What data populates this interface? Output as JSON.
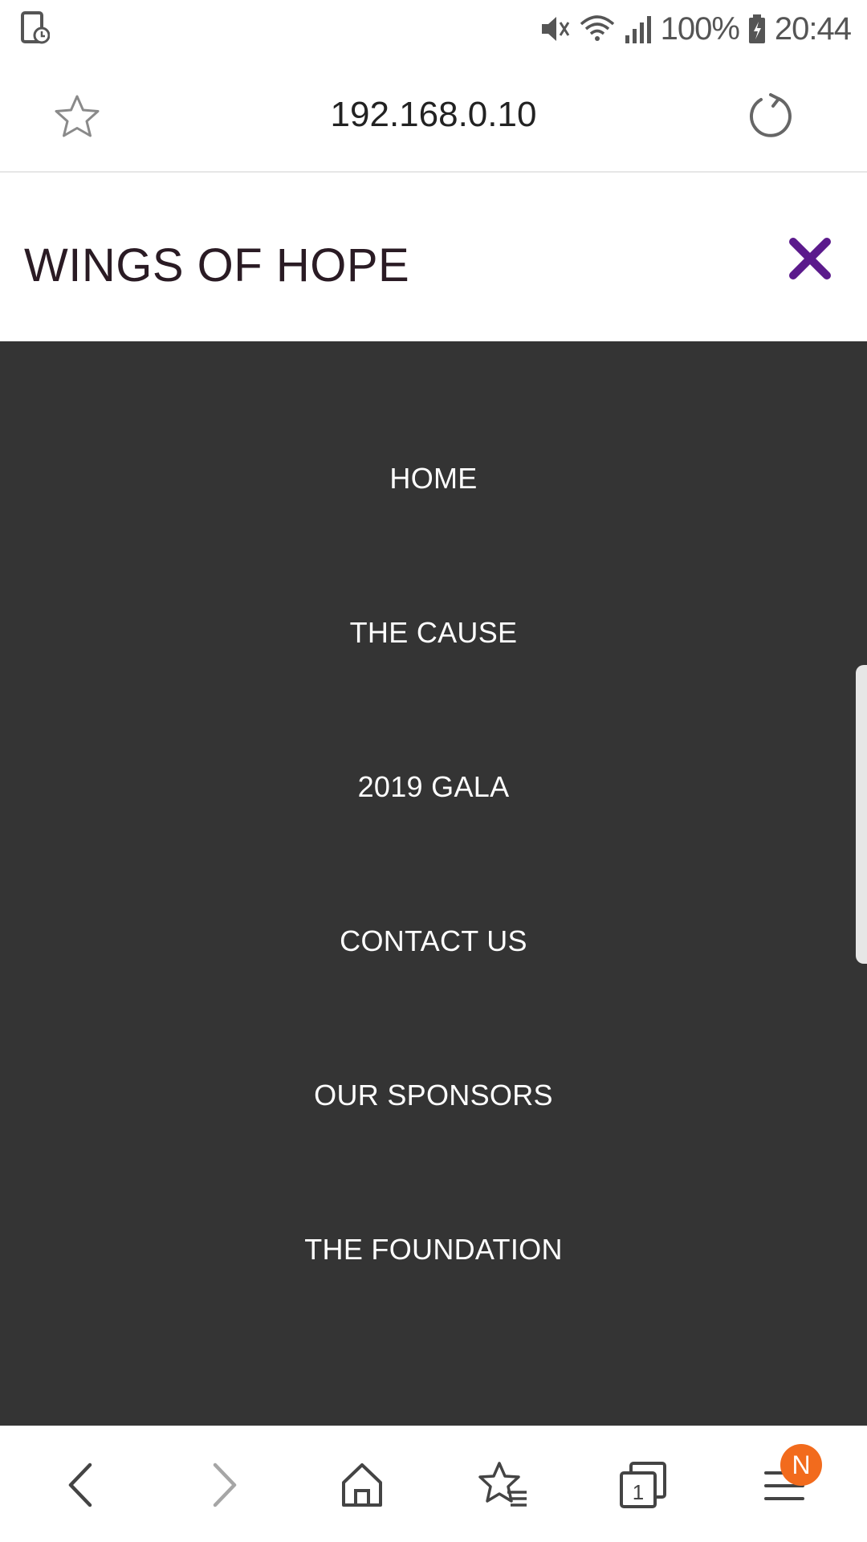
{
  "status_bar": {
    "battery": "100%",
    "time": "20:44",
    "icons": [
      "screen-record-icon",
      "mute-icon",
      "wifi-icon",
      "signal-icon",
      "battery-charging-icon"
    ]
  },
  "browser": {
    "url": "192.168.0.10",
    "icons": [
      "bookmark-star-icon",
      "reload-icon"
    ]
  },
  "site": {
    "title": "WINGS OF HOPE",
    "accent_color": "#5b1a8c",
    "close_icon": "close-icon"
  },
  "menu": {
    "background": "#343434",
    "items": [
      {
        "label": "HOME"
      },
      {
        "label": "THE CAUSE"
      },
      {
        "label": "2019 GALA"
      },
      {
        "label": "CONTACT US"
      },
      {
        "label": "OUR SPONSORS"
      },
      {
        "label": "THE FOUNDATION"
      }
    ]
  },
  "toolbar": {
    "icons": [
      "back-icon",
      "forward-icon",
      "home-icon",
      "bookmarks-icon",
      "tabs-icon",
      "menu-icon"
    ],
    "tab_count": "1",
    "menu_badge": "N",
    "badge_color": "#f26b1d"
  }
}
